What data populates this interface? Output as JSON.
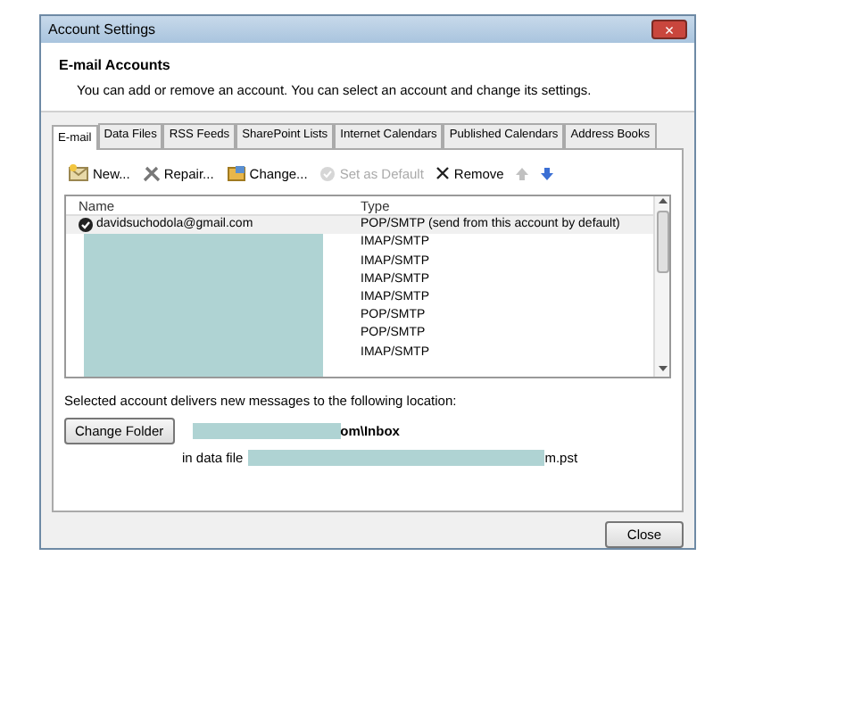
{
  "window": {
    "title": "Account Settings",
    "close_glyph": "×"
  },
  "header": {
    "title": "E-mail Accounts",
    "description": "You can add or remove an account. You can select an account and change its settings."
  },
  "tabs": [
    {
      "label": "E-mail",
      "selected": true
    },
    {
      "label": "Data Files",
      "selected": false
    },
    {
      "label": "RSS Feeds",
      "selected": false
    },
    {
      "label": "SharePoint Lists",
      "selected": false
    },
    {
      "label": "Internet Calendars",
      "selected": false
    },
    {
      "label": "Published Calendars",
      "selected": false
    },
    {
      "label": "Address Books",
      "selected": false
    }
  ],
  "toolbar": [
    {
      "kind": "new",
      "label": "New...",
      "disabled": false
    },
    {
      "kind": "repair",
      "label": "Repair...",
      "disabled": false
    },
    {
      "kind": "change",
      "label": "Change...",
      "disabled": false
    },
    {
      "kind": "default",
      "label": "Set as Default",
      "disabled": true
    },
    {
      "kind": "remove",
      "label": "Remove",
      "disabled": false
    },
    {
      "kind": "up",
      "disabled": true
    },
    {
      "kind": "down",
      "disabled": false
    }
  ],
  "accounts": {
    "columns": [
      "Name",
      "Type"
    ],
    "rows": [
      {
        "name": "davidsuchodola@gmail.com",
        "type": "POP/SMTP (send from this account by default)",
        "default": true
      },
      {
        "type": "IMAP/SMTP",
        "default": false
      },
      {
        "type": "IMAP/SMTP",
        "default": false
      },
      {
        "type": "IMAP/SMTP",
        "default": false
      },
      {
        "type": "IMAP/SMTP",
        "default": false
      },
      {
        "type": "POP/SMTP",
        "default": false
      },
      {
        "type": "POP/SMTP",
        "default": false
      },
      {
        "type": "IMAP/SMTP",
        "default": false
      }
    ]
  },
  "location": {
    "description": "Selected account delivers new messages to the following location:",
    "button": "Change Folder",
    "folder_tail": "om\\Inbox",
    "data_file_label": "in data file",
    "data_file_tail": "m.pst"
  },
  "buttons": [
    "Close"
  ]
}
